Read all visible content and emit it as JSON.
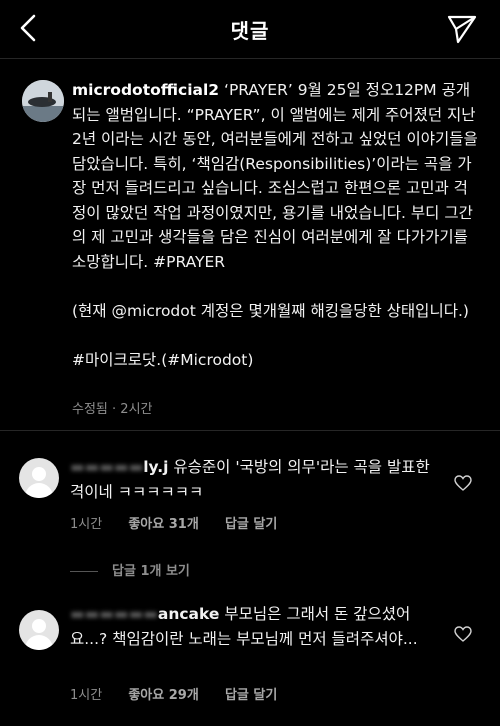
{
  "header": {
    "title": "댓글",
    "back_icon": "chevron-left-icon",
    "send_icon": "paper-plane-icon"
  },
  "post": {
    "username": "microdotofficial2",
    "caption": " ‘PRAYER’ 9월 25일 정오12PM 공개되는 앨범입니다. “PRAYER”, 이 앨범에는 제게 주어졌던 지난 2년 이라는 시간 동안, 여러분들에게 전하고 싶었던 이야기들을 담았습니다. 특히, ‘책임감(Responsibilities)’이라는 곡을 가장 먼저 들려드리고 싶습니다. 조심스럽고 한편으론 고민과 걱정이 많았던 작업 과정이였지만, 용기를 내었습니다. 부디 그간의 제 고민과 생각들을 담은 진심이 여러분에게 잘 다가가기를 소망합니다. #PRAYER",
    "note": "(현재 @microdot 계정은 몇개월째 해킹을당한 상태입니다.)",
    "hashtag": "#마이크로닷.(#Microdot)",
    "edited": "수정됨",
    "time": "2시간"
  },
  "comments": [
    {
      "username_visible": "ly.j",
      "text": " 유승준이 '국방의 의무'라는 곡을 발표한 격이네 ㅋㅋㅋㅋㅋㅋ",
      "time": "1시간",
      "likes": "좋아요 31개",
      "reply": "답글 달기",
      "view_replies": "답글 1개 보기"
    },
    {
      "username_visible": "ancake",
      "text": " 부모님은 그래서 돈 갚으셨어요...? 책임감이란 노래는 부모님께 먼저 들려주셔야...",
      "time": "1시간",
      "likes": "좋아요 29개",
      "reply": "답글 달기"
    }
  ]
}
